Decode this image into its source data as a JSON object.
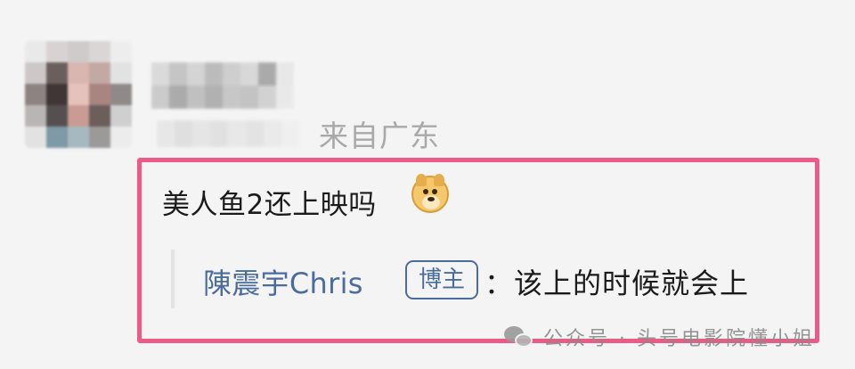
{
  "comment": {
    "location": "来自广东",
    "text": "美人鱼2还上映吗",
    "emoji_icon": "doge-emoji-icon"
  },
  "reply": {
    "author": "陳震宇Chris",
    "badge": "博主",
    "text": "：该上的时候就会上"
  },
  "watermark": {
    "icon": "wechat-icon",
    "text": "公众号 · 头号电影院懂小姐"
  },
  "colors": {
    "highlight": "#ec5a86",
    "author": "#4b6c9f",
    "location": "#a9a9a9"
  }
}
